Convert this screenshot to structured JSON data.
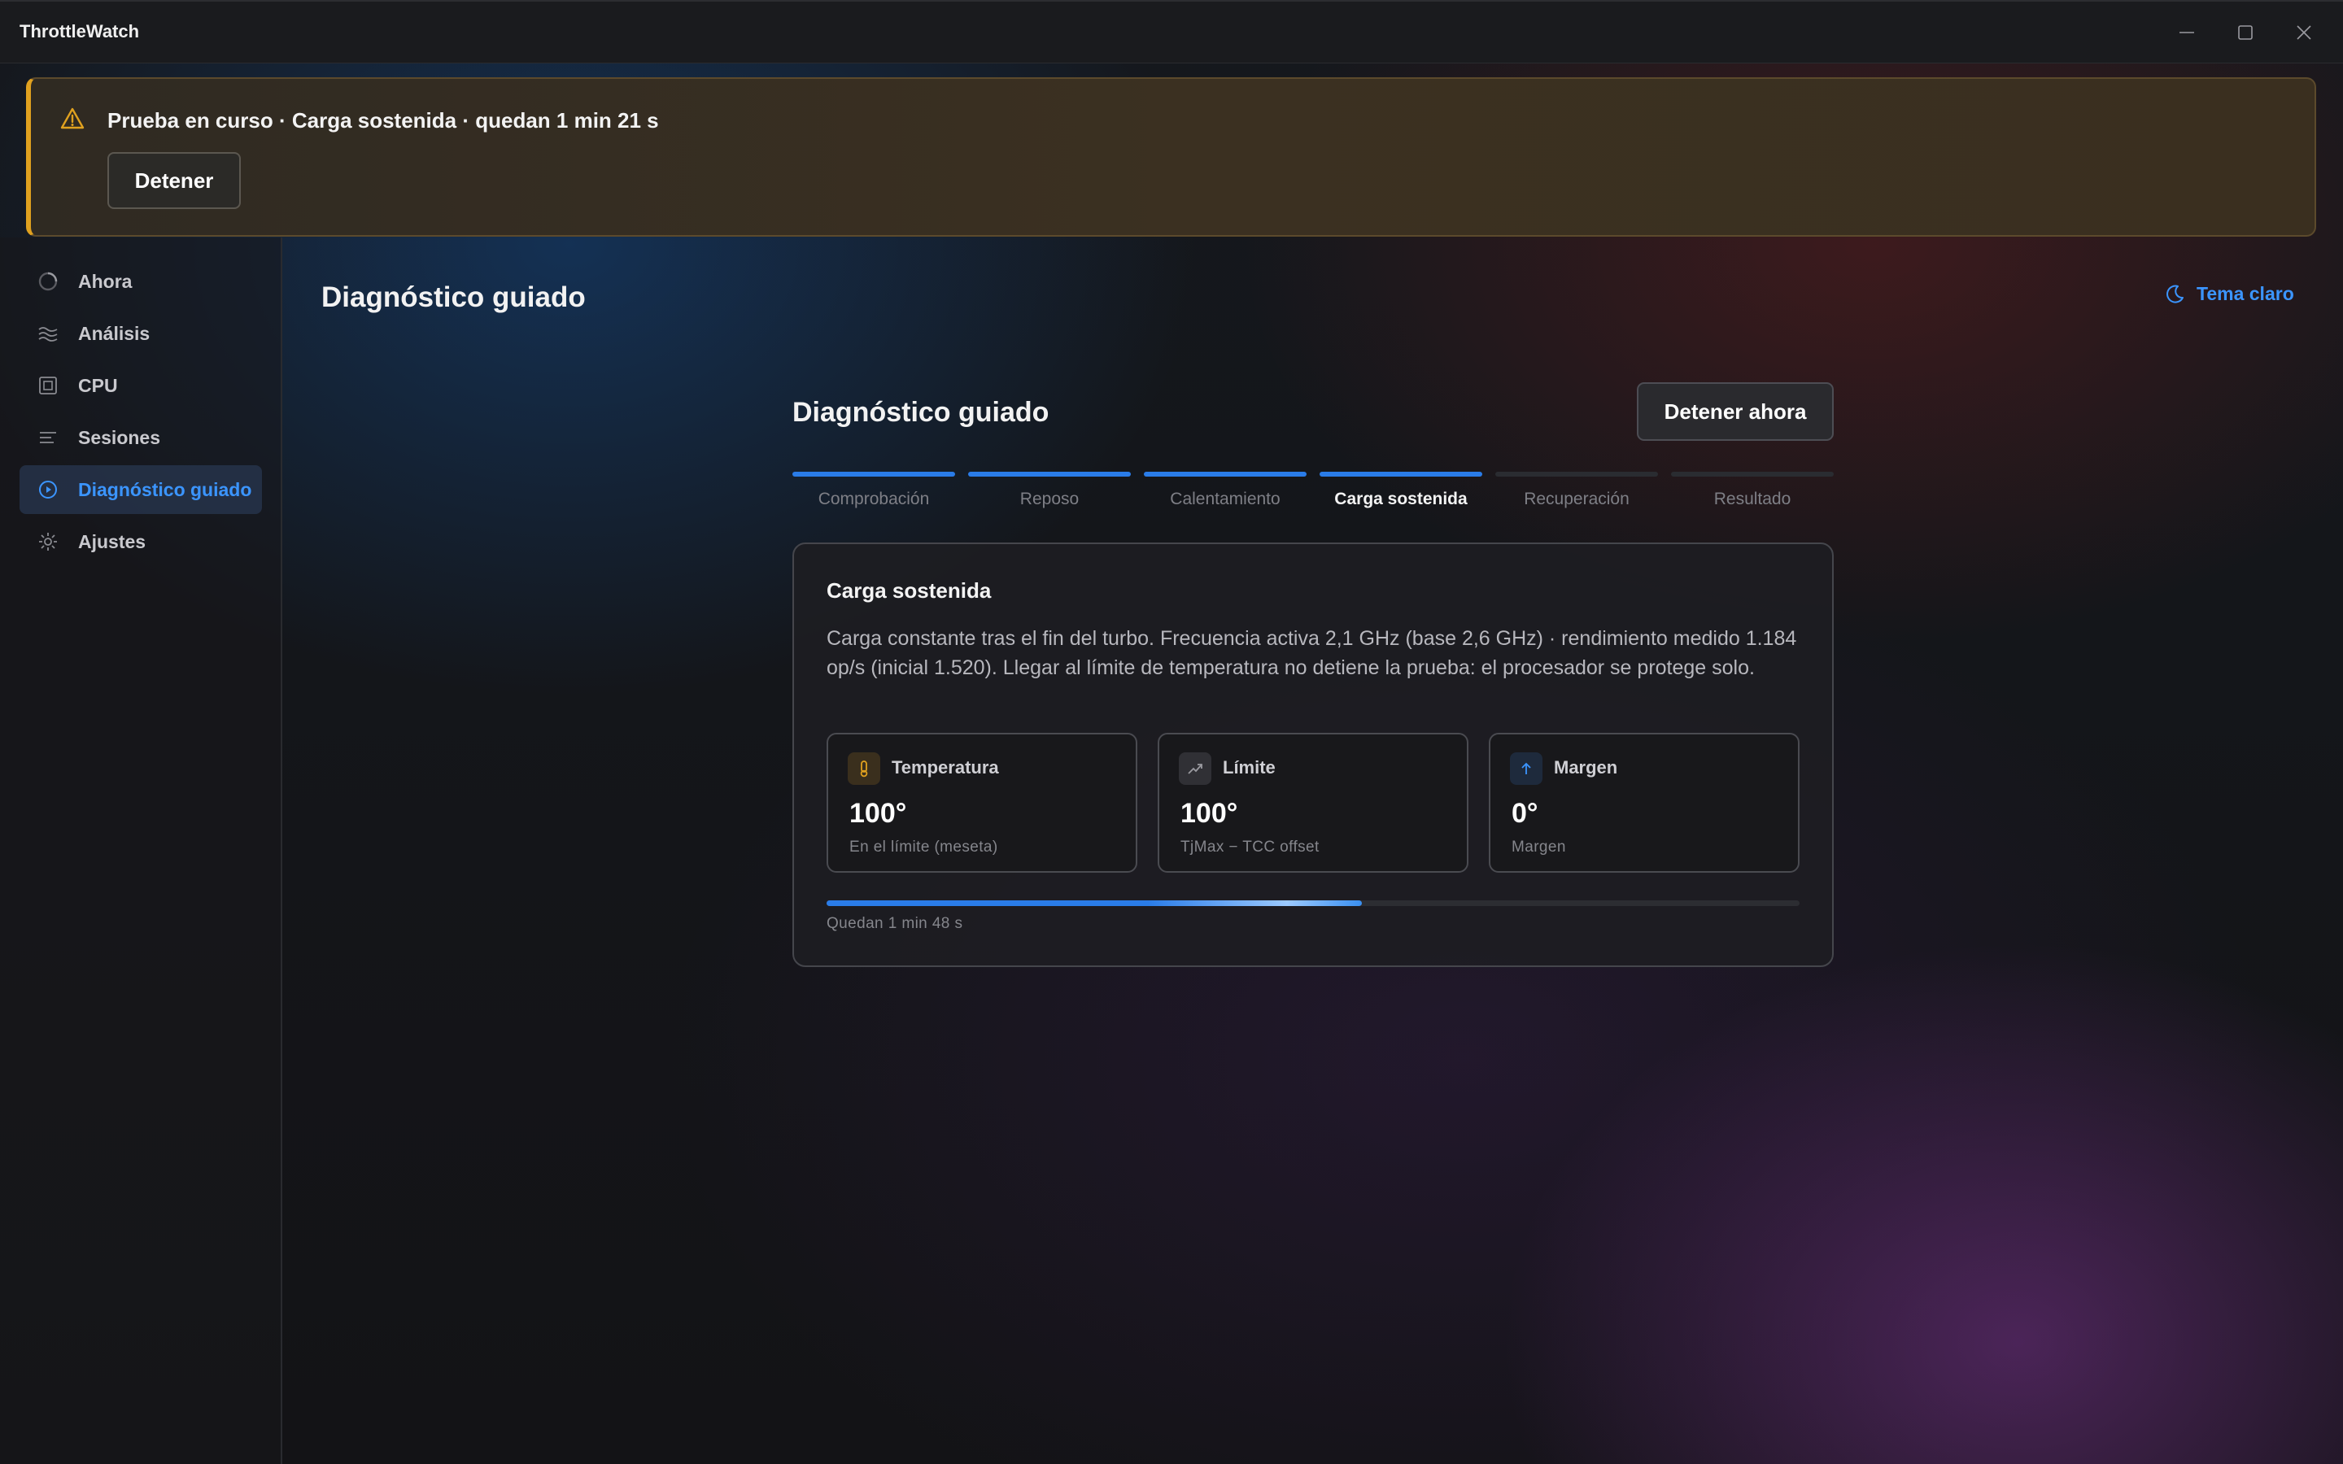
{
  "app": {
    "title": "ThrottleWatch",
    "window_controls": [
      "minimize-icon",
      "maximize-icon",
      "close-icon"
    ]
  },
  "banner": {
    "icon": "warning-icon",
    "message": "Prueba en curso · Carga sostenida · quedan 1 min 21 s",
    "button": "Detener",
    "accent_color": "#e0a11f"
  },
  "sidebar": {
    "items": [
      {
        "label": "Ahora",
        "icon": "gauge-icon",
        "active": false
      },
      {
        "label": "Análisis",
        "icon": "waves-icon",
        "active": false
      },
      {
        "label": "CPU",
        "icon": "cpu-icon",
        "active": false
      },
      {
        "label": "Sesiones",
        "icon": "list-icon",
        "active": false
      },
      {
        "label": "Diagnóstico guiado",
        "icon": "play-circle-icon",
        "active": true
      },
      {
        "label": "Ajustes",
        "icon": "gear-icon",
        "active": false
      }
    ],
    "active_color": "#3b95ff"
  },
  "header": {
    "title": "Diagnóstico guiado",
    "theme_toggle": "Tema claro",
    "theme_icon": "moon-icon"
  },
  "wizard": {
    "title": "Diagnóstico guiado",
    "stop_button": "Detener ahora",
    "steps": [
      {
        "label": "Comprobación",
        "state": "done"
      },
      {
        "label": "Reposo",
        "state": "done"
      },
      {
        "label": "Calentamiento",
        "state": "done"
      },
      {
        "label": "Carga sostenida",
        "state": "current"
      },
      {
        "label": "Recuperación",
        "state": "pending"
      },
      {
        "label": "Resultado",
        "state": "pending"
      }
    ],
    "card": {
      "title": "Carga sostenida",
      "description": "Carga constante tras el fin del turbo. Frecuencia activa 2,1 GHz (base 2,6 GHz) · rendimiento medido 1.184 op/s (inicial 1.520). Llegar al límite de temperatura no detiene la prueba: el procesador se protege solo.",
      "metrics": [
        {
          "icon": "thermometer-icon",
          "name": "Temperatura",
          "value": "100°",
          "sub": "En el límite (meseta)",
          "icon_color": "#e0a11f"
        },
        {
          "icon": "trend-up-icon",
          "name": "Límite",
          "value": "100°",
          "sub": "TjMax − TCC offset",
          "icon_color": "#9a9aa0"
        },
        {
          "icon": "arrow-up-icon",
          "name": "Margen",
          "value": "0°",
          "sub": "Margen",
          "icon_color": "#3b95ff"
        }
      ],
      "progress": 0.55,
      "progress_text": "Quedan 1 min 48 s"
    }
  }
}
